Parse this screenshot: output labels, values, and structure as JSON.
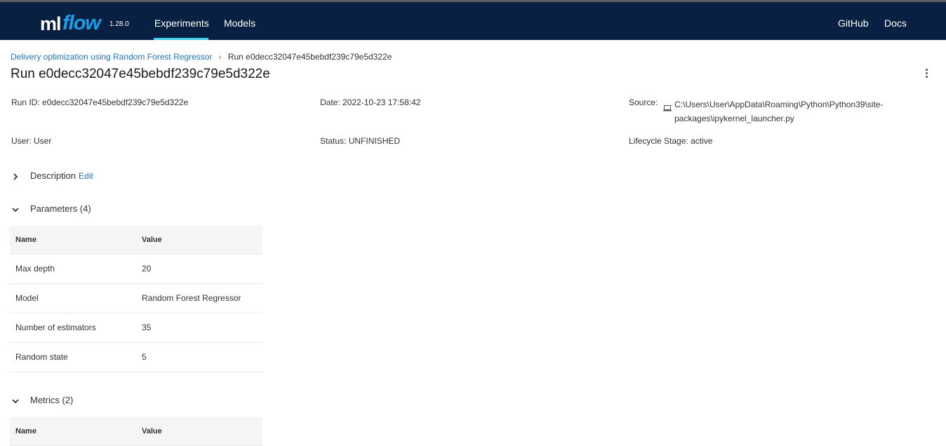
{
  "navbar": {
    "logo_ml": "ml",
    "logo_flow": "flow",
    "version": "1.28.0",
    "items": [
      {
        "label": "Experiments",
        "active": true
      },
      {
        "label": "Models",
        "active": false
      }
    ],
    "right_links": [
      {
        "label": "GitHub"
      },
      {
        "label": "Docs"
      }
    ],
    "colors": {
      "background": "#082142",
      "active_underline": "#43c9ed",
      "logo_accent": "#1f9ee7"
    }
  },
  "breadcrumb": {
    "parent": "Delivery optimization using Random Forest Regressor",
    "separator": "›",
    "current": "Run e0decc32047e45bebdf239c79e5d322e"
  },
  "page": {
    "title": "Run e0decc32047e45bebdf239c79e5d322e",
    "menu_icon": "kebab-menu-icon"
  },
  "run_info": {
    "run_id_label": "Run ID:",
    "run_id": "e0decc32047e45bebdf239c79e5d322e",
    "date_label": "Date:",
    "date": "2022-10-23 17:58:42",
    "source_label": "Source:",
    "source_icon": "laptop-icon",
    "source_line1": "C:\\Users\\User\\AppData\\Roaming\\Python\\Python39\\site-",
    "source_line2": "packages\\ipykernel_launcher.py",
    "user_label": "User:",
    "user": "User",
    "status_label": "Status:",
    "status": "UNFINISHED",
    "lifecycle_label": "Lifecycle Stage:",
    "lifecycle": "active"
  },
  "sections": {
    "description": {
      "label": "Description",
      "edit": "Edit",
      "expanded": false
    },
    "parameters": {
      "label": "Parameters (4)",
      "expanded": true,
      "columns": [
        "Name",
        "Value"
      ],
      "rows": [
        [
          "Max depth",
          "20"
        ],
        [
          "Model",
          "Random Forest Regressor"
        ],
        [
          "Number of estimators",
          "35"
        ],
        [
          "Random state",
          "5"
        ]
      ]
    },
    "metrics": {
      "label": "Metrics (2)",
      "expanded": true,
      "columns": [
        "Name",
        "Value"
      ]
    }
  }
}
